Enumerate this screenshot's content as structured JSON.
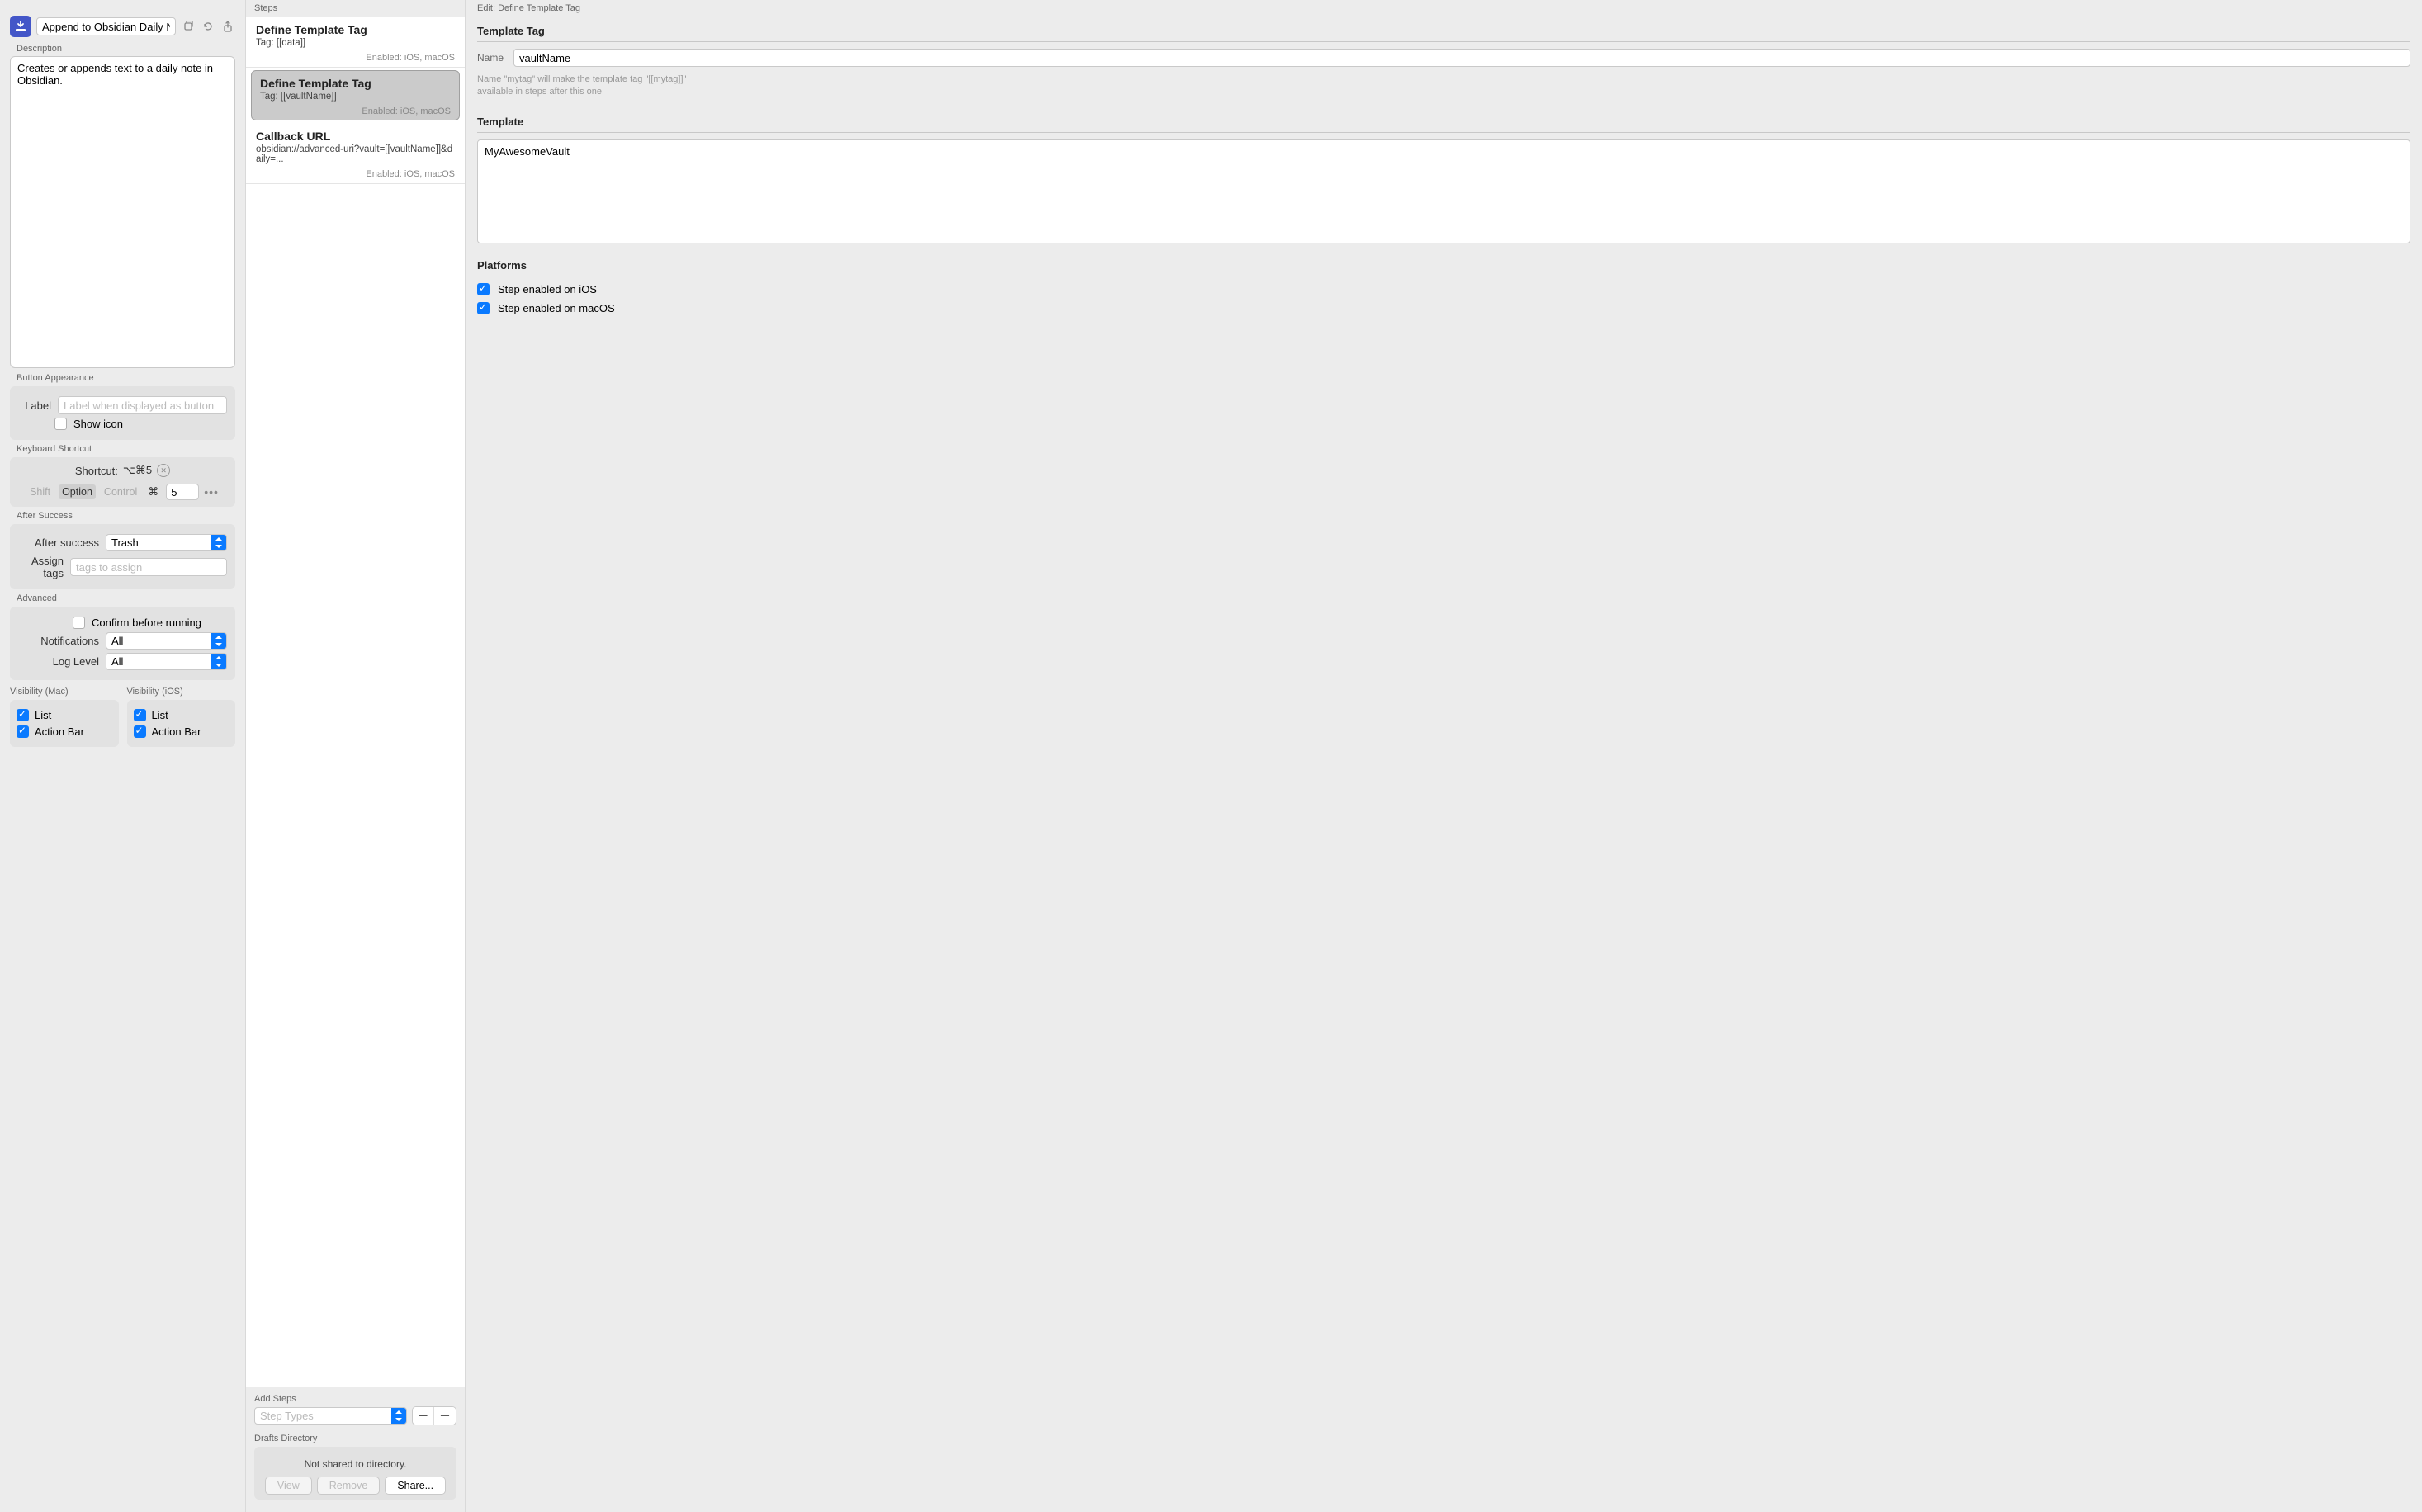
{
  "left": {
    "action_name": "Append to Obsidian Daily No",
    "description_label": "Description",
    "description_value": "Creates or appends text to a daily note in Obsidian.",
    "button_appearance_label": "Button Appearance",
    "label_label": "Label",
    "label_placeholder": "Label when displayed as button",
    "show_icon_label": "Show icon",
    "show_icon_checked": false,
    "keyboard_shortcut_label": "Keyboard Shortcut",
    "shortcut_display_prefix": "Shortcut:",
    "shortcut_display_value": "⌥⌘5",
    "mod_shift": "Shift",
    "mod_option": "Option",
    "mod_control": "Control",
    "mod_cmd_symbol": "⌘",
    "shortcut_key": "5",
    "after_success_label": "After Success",
    "after_success_field_label": "After success",
    "after_success_value": "Trash",
    "assign_tags_label": "Assign tags",
    "assign_tags_placeholder": "tags to assign",
    "advanced_label": "Advanced",
    "confirm_label": "Confirm before running",
    "confirm_checked": false,
    "notifications_label": "Notifications",
    "notifications_value": "All",
    "log_level_label": "Log Level",
    "log_level_value": "All",
    "vis_mac_label": "Visibility (Mac)",
    "vis_ios_label": "Visibility (iOS)",
    "vis_list": "List",
    "vis_actionbar": "Action Bar"
  },
  "mid": {
    "steps_header": "Steps",
    "steps": [
      {
        "title": "Define Template Tag",
        "sub": "Tag: [[data]]",
        "enabled": "Enabled: iOS, macOS",
        "selected": false
      },
      {
        "title": "Define Template Tag",
        "sub": "Tag: [[vaultName]]",
        "enabled": "Enabled: iOS, macOS",
        "selected": true
      },
      {
        "title": "Callback URL",
        "sub": "obsidian://advanced-uri?vault=[[vaultName]]&daily=...",
        "enabled": "Enabled: iOS, macOS",
        "selected": false
      }
    ],
    "add_steps_label": "Add Steps",
    "step_types_placeholder": "Step Types",
    "directory_label": "Drafts Directory",
    "directory_status": "Not shared to directory.",
    "btn_view": "View",
    "btn_remove": "Remove",
    "btn_share": "Share..."
  },
  "right": {
    "header": "Edit: Define Template Tag",
    "section_tag": "Template Tag",
    "name_label": "Name",
    "name_value": "vaultName",
    "hint_line1": "Name \"mytag\" will make the template tag \"[[mytag]]\"",
    "hint_line2": "available in steps after this one",
    "section_template": "Template",
    "template_value": "MyAwesomeVault",
    "section_platforms": "Platforms",
    "ios_label": "Step enabled on iOS",
    "macos_label": "Step enabled on macOS"
  }
}
